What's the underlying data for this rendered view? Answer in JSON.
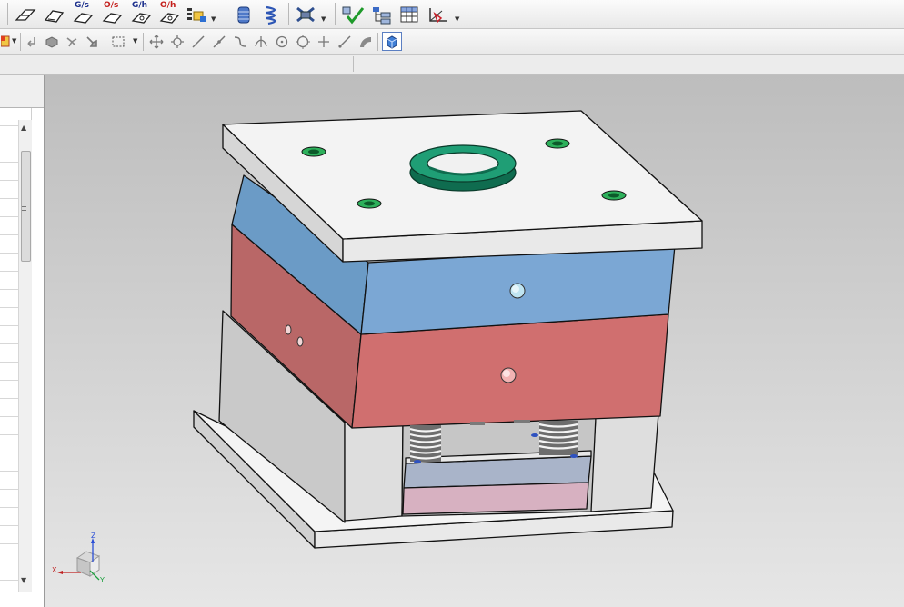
{
  "toolbar": {
    "gate_labels": [
      "G/s",
      "O/s",
      "G/h",
      "O/h"
    ]
  },
  "triad": {
    "x_label": "X",
    "y_label": "Y",
    "z_label": "Z"
  },
  "colors": {
    "top_clamp_plate": "#f2f2f2",
    "a_plate": "#7ba7d4",
    "b_plate": "#d06f6f",
    "support_blocks": "#d9d9d9",
    "locating_ring": "#1f9e75",
    "ejector_retainer": "#a9b4c9",
    "ejector_plate": "#d7b1c1",
    "viewport_top": "#bdbdbd",
    "viewport_bottom": "#e6e6e6"
  },
  "icons": {
    "row1": [
      "pointer-icon",
      "face-select-icon",
      "gate-side-icon",
      "overflow-side-icon",
      "gate-hole-icon",
      "overflow-hole-icon",
      "list-icon",
      "cylinder-icon",
      "spring-icon",
      "cooling-icon",
      "check-icon",
      "tree-icon",
      "table-icon",
      "view-icon"
    ],
    "row2": [
      "color-icon",
      "undo-icon",
      "part-icon",
      "snap-icon",
      "tool-icon",
      "box-select-icon",
      "move-icon",
      "rotate-icon",
      "line-icon",
      "curve-icon",
      "arc-icon",
      "point-icon",
      "circle-icon",
      "cross-icon",
      "slash-icon",
      "angle-icon",
      "shaded-cube-icon"
    ]
  }
}
